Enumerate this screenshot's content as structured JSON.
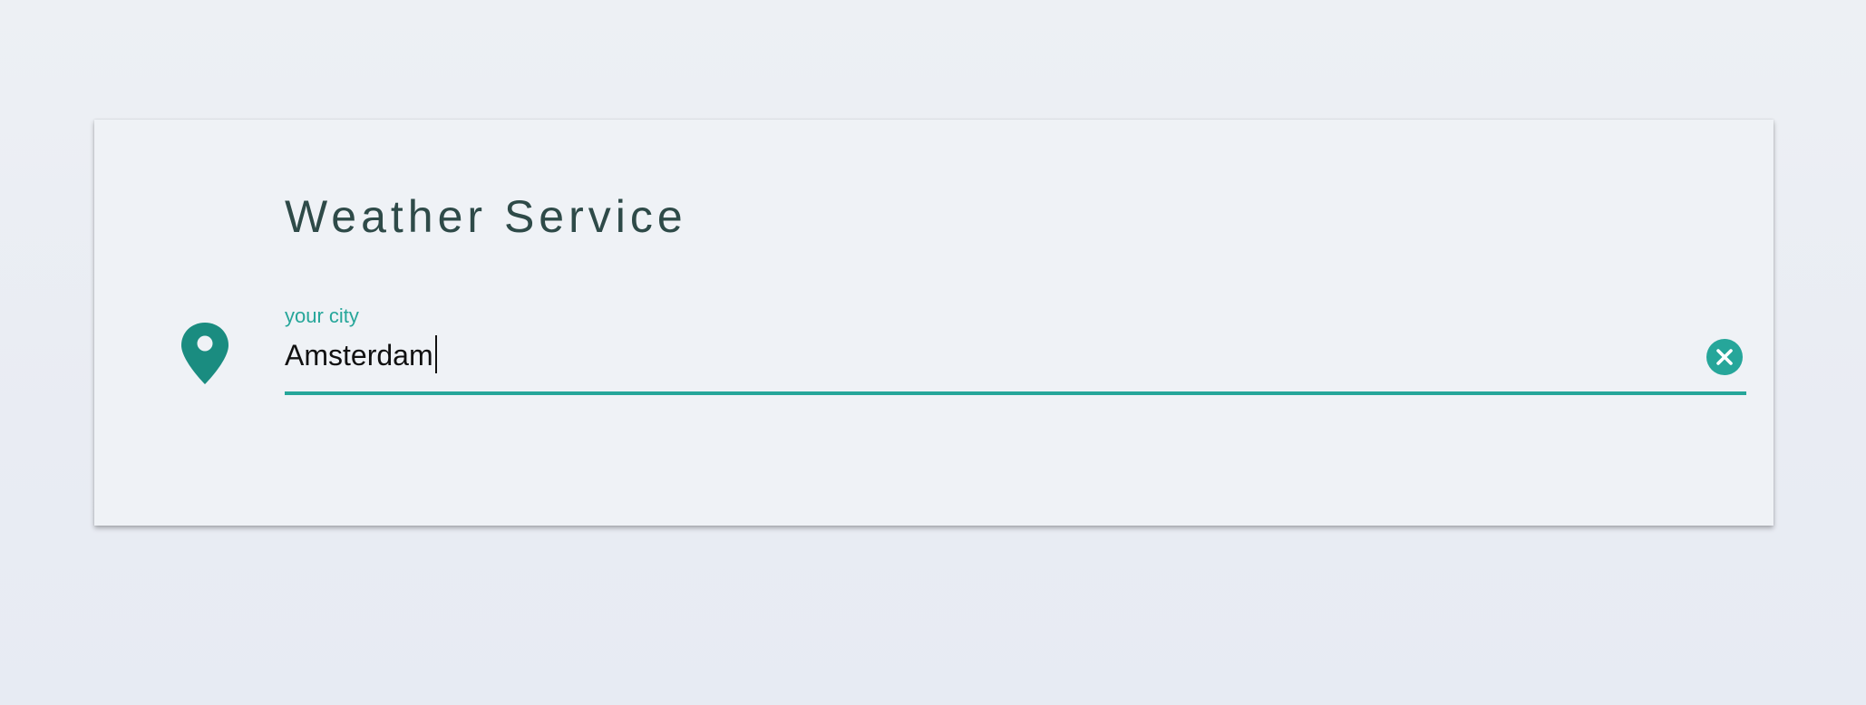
{
  "app": {
    "title": "Weather Service"
  },
  "city_field": {
    "label": "your city",
    "value": "Amsterdam",
    "clear_icon": "close-circle-icon",
    "location_icon": "map-marker-icon"
  },
  "colors": {
    "accent": "#26a69a",
    "pin": "#1a8c80",
    "title": "#2e4a48",
    "card": "#eff2f6",
    "background": "#eaedf3"
  }
}
